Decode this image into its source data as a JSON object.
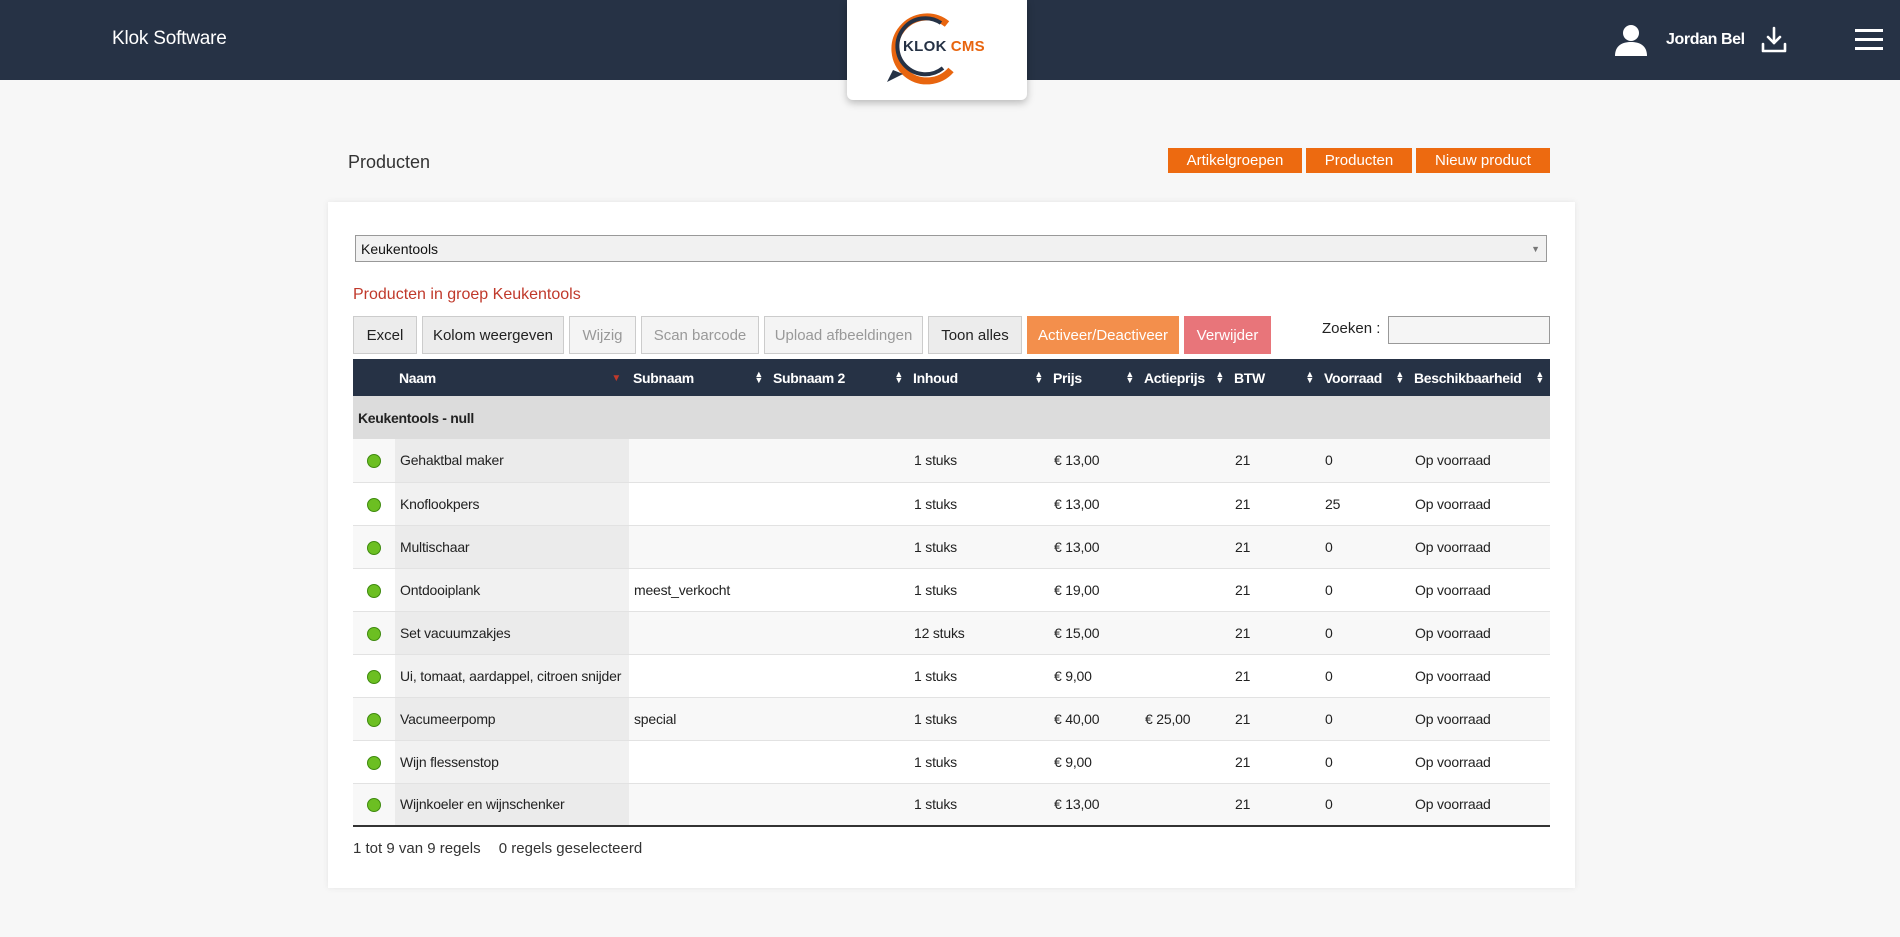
{
  "header": {
    "brand": "Klok Software",
    "logo_klok": "KLOK",
    "logo_cms": "CMS",
    "user_name": "Jordan Bel",
    "icons": [
      "user-icon",
      "download-icon",
      "hamburger-menu-icon"
    ]
  },
  "page": {
    "title": "Producten",
    "nav_buttons": [
      "Artikelgroepen",
      "Producten",
      "Nieuw product"
    ]
  },
  "filter": {
    "selected_group": "Keukentools"
  },
  "list": {
    "heading": "Producten in groep Keukentools",
    "toolbar": {
      "excel": "Excel",
      "columns": "Kolom weergeven",
      "edit": "Wijzig",
      "scan": "Scan barcode",
      "upload": "Upload afbeeldingen",
      "show_all": "Toon alles",
      "toggle_active": "Activeer/Deactiveer",
      "delete": "Verwijder"
    },
    "search_label": "Zoeken :",
    "search_value": "",
    "columns": [
      "Naam",
      "Subnaam",
      "Subnaam 2",
      "Inhoud",
      "Prijs",
      "Actieprijs",
      "BTW",
      "Voorraad",
      "Beschikbaarheid"
    ],
    "group_label": "Keukentools - null",
    "rows": [
      {
        "name": "Gehaktbal maker",
        "subname": "",
        "subname2": "",
        "content": "1 stuks",
        "price": "€ 13,00",
        "action_price": "",
        "btw": "21",
        "stock": "0",
        "availability": "Op voorraad"
      },
      {
        "name": "Knoflookpers",
        "subname": "",
        "subname2": "",
        "content": "1 stuks",
        "price": "€ 13,00",
        "action_price": "",
        "btw": "21",
        "stock": "25",
        "availability": "Op voorraad"
      },
      {
        "name": "Multischaar",
        "subname": "",
        "subname2": "",
        "content": "1 stuks",
        "price": "€ 13,00",
        "action_price": "",
        "btw": "21",
        "stock": "0",
        "availability": "Op voorraad"
      },
      {
        "name": "Ontdooiplank",
        "subname": "meest_verkocht",
        "subname2": "",
        "content": "1 stuks",
        "price": "€ 19,00",
        "action_price": "",
        "btw": "21",
        "stock": "0",
        "availability": "Op voorraad"
      },
      {
        "name": "Set vacuumzakjes",
        "subname": "",
        "subname2": "",
        "content": "12 stuks",
        "price": "€ 15,00",
        "action_price": "",
        "btw": "21",
        "stock": "0",
        "availability": "Op voorraad"
      },
      {
        "name": "Ui, tomaat, aardappel, citroen snijder",
        "subname": "",
        "subname2": "",
        "content": "1 stuks",
        "price": "€ 9,00",
        "action_price": "",
        "btw": "21",
        "stock": "0",
        "availability": "Op voorraad"
      },
      {
        "name": "Vacumeerpomp",
        "subname": "special",
        "subname2": "",
        "content": "1 stuks",
        "price": "€ 40,00",
        "action_price": "€ 25,00",
        "btw": "21",
        "stock": "0",
        "availability": "Op voorraad"
      },
      {
        "name": "Wijn flessenstop",
        "subname": "",
        "subname2": "",
        "content": "1 stuks",
        "price": "€ 9,00",
        "action_price": "",
        "btw": "21",
        "stock": "0",
        "availability": "Op voorraad"
      },
      {
        "name": "Wijnkoeler en wijnschenker",
        "subname": "",
        "subname2": "",
        "content": "1 stuks",
        "price": "€ 13,00",
        "action_price": "",
        "btw": "21",
        "stock": "0",
        "availability": "Op voorraad"
      }
    ],
    "footer_range": "1 tot 9 van 9 regels",
    "footer_selected": "0 regels geselecteerd"
  },
  "colors": {
    "topbar": "#263245",
    "accent_orange": "#ed6a10",
    "status_active": "#6cbf22",
    "delete_red": "#e8757a",
    "heading_red": "#c0392b"
  }
}
